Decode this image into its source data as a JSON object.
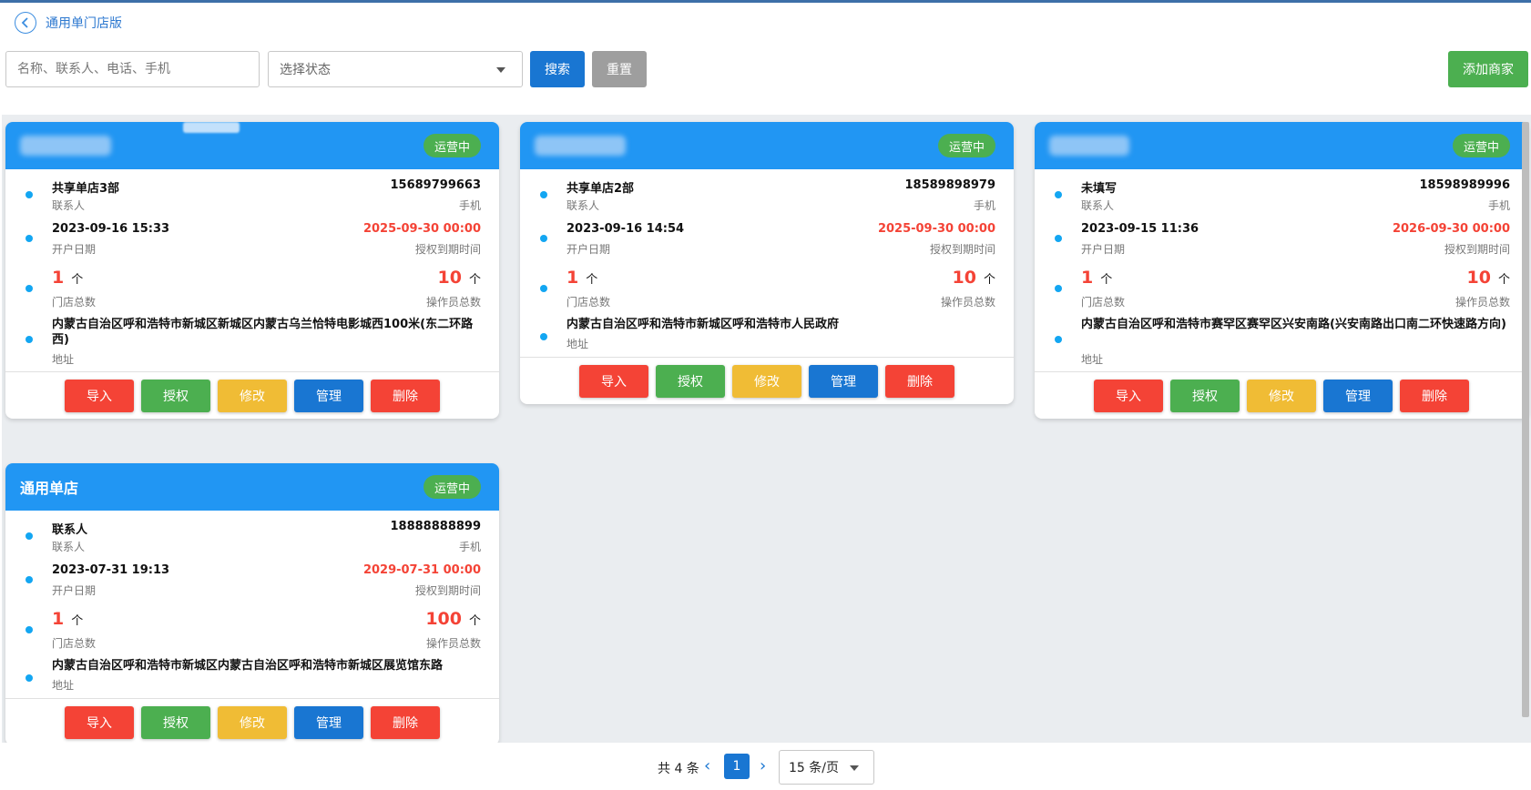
{
  "nav": {
    "title": "通用单门店版"
  },
  "toolbar": {
    "search_placeholder": "名称、联系人、电话、手机",
    "status_placeholder": "选择状态",
    "search_label": "搜索",
    "reset_label": "重置",
    "add_label": "添加商家"
  },
  "labels": {
    "contact": "联系人",
    "mobile": "手机",
    "open_date": "开户日期",
    "expire": "授权到期时间",
    "stores": "门店总数",
    "operators": "操作员总数",
    "address": "地址",
    "unit": "个"
  },
  "actions": {
    "import": "导入",
    "auth": "授权",
    "edit": "修改",
    "manage": "管理",
    "delete": "删除"
  },
  "cards": [
    {
      "title": "",
      "status": "运营中",
      "contact": "共享单店3部",
      "mobile": "15689799663",
      "open_date": "2023-09-16 15:33",
      "expire": "2025-09-30 00:00",
      "stores": "1",
      "operators": "10",
      "address": "内蒙古自治区呼和浩特市新城区新城区内蒙古乌兰恰特电影城西100米(东二环路西)"
    },
    {
      "title": "",
      "status": "运营中",
      "contact": "共享单店2部",
      "mobile": "18589898979",
      "open_date": "2023-09-16 14:54",
      "expire": "2025-09-30 00:00",
      "stores": "1",
      "operators": "10",
      "address": "内蒙古自治区呼和浩特市新城区呼和浩特市人民政府"
    },
    {
      "title": "",
      "status": "运营中",
      "contact": "未填写",
      "mobile": "18598989996",
      "open_date": "2023-09-15 11:36",
      "expire": "2026-09-30 00:00",
      "stores": "1",
      "operators": "10",
      "address": "内蒙古自治区呼和浩特市赛罕区赛罕区兴安南路(兴安南路出口南二环快速路方向)"
    },
    {
      "title": "通用单店",
      "status": "运营中",
      "contact": "联系人",
      "mobile": "18888888899",
      "open_date": "2023-07-31 19:13",
      "expire": "2029-07-31 00:00",
      "stores": "1",
      "operators": "100",
      "address": "内蒙古自治区呼和浩特市新城区内蒙古自治区呼和浩特市新城区展览馆东路"
    }
  ],
  "pagination": {
    "total": "共 4 条",
    "current": "1",
    "page_size": "15 条/页"
  }
}
